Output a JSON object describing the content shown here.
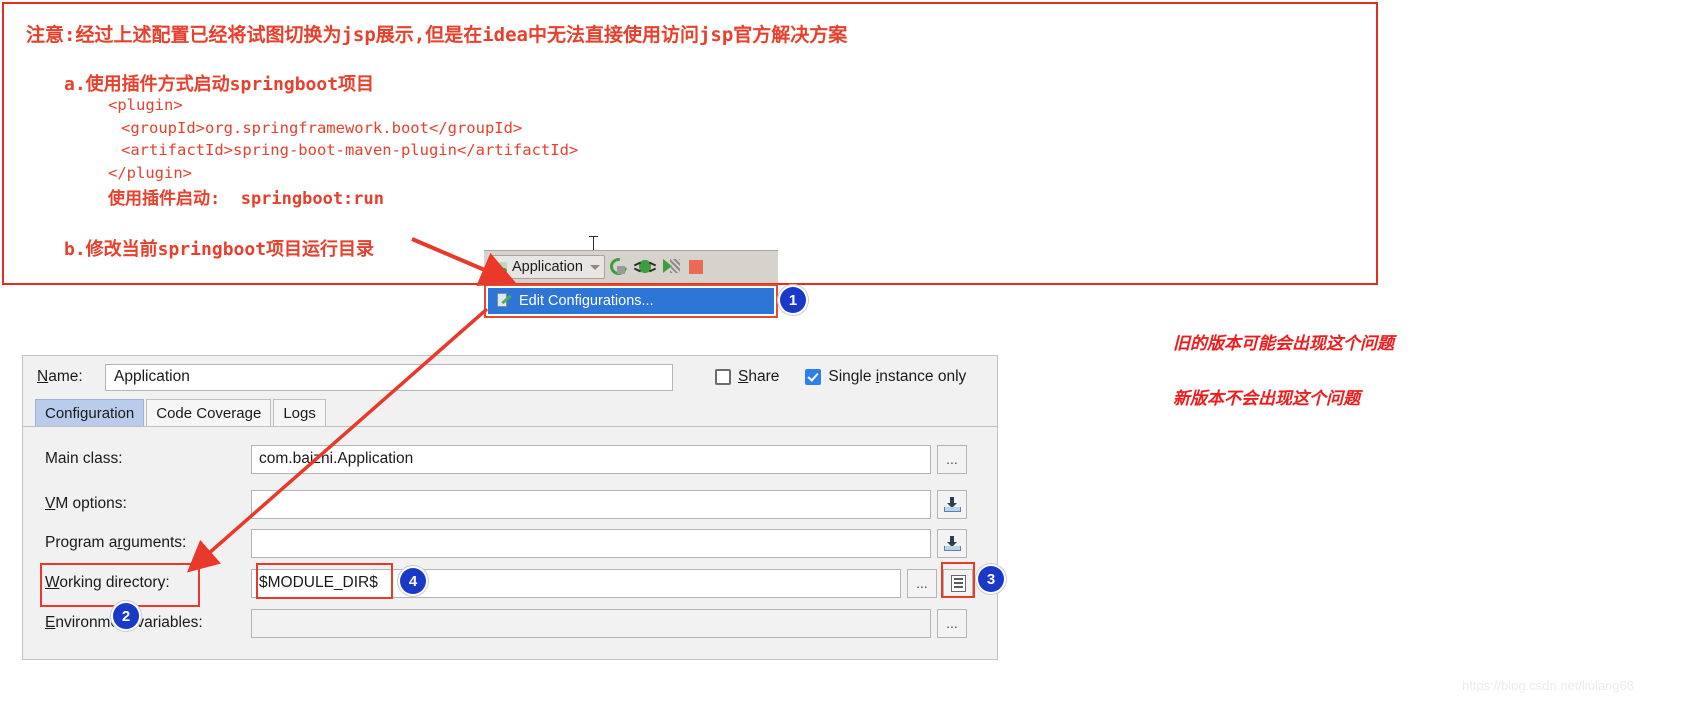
{
  "note": {
    "title": "注意:经过上述配置已经将试图切换为jsp展示,但是在idea中无法直接使用访问jsp官方解决方案",
    "item_a": "a.使用插件方式启动springboot项目",
    "code": [
      "<plugin>",
      "<groupId>org.springframework.boot</groupId>",
      "<artifactId>spring-boot-maven-plugin</artifactId>",
      "</plugin>",
      "使用插件启动:  springboot:run"
    ],
    "item_b": "b.修改当前springboot项目运行目录"
  },
  "toolbar": {
    "run_config_name": "Application",
    "icons": [
      "spring-leaf-icon",
      "chevron-down-icon",
      "run-icon",
      "debug-icon",
      "run-with-coverage-icon",
      "stop-icon"
    ]
  },
  "popup": {
    "edit_configurations_label": "Edit Configurations..."
  },
  "dialog": {
    "name_label": "Name:",
    "name_value": "Application",
    "share_label": "Share",
    "share_checked": false,
    "single_instance_label": "Single instance only",
    "single_instance_checked": true,
    "tabs": [
      {
        "label": "Configuration",
        "active": true
      },
      {
        "label": "Code Coverage",
        "active": false
      },
      {
        "label": "Logs",
        "active": false
      }
    ],
    "fields": [
      {
        "label": "Main class:",
        "value": "com.baizhi.Application",
        "aux": "ellipsis"
      },
      {
        "label": "VM options:",
        "value": "",
        "aux": "macro"
      },
      {
        "label": "Program arguments:",
        "value": "",
        "aux": "macro"
      },
      {
        "label": "Working directory:",
        "value": "$MODULE_DIR$",
        "aux": "ellipsis-and-lines"
      },
      {
        "label": "Environment variables:",
        "value": "",
        "aux": "ellipsis"
      }
    ],
    "aux_ellipsis_label": "..."
  },
  "badges": [
    "1",
    "2",
    "3",
    "4"
  ],
  "side_notes": {
    "old_version": "旧的版本可能会出现这个问题",
    "new_version": "新版本不会出现这个问题"
  },
  "watermark": "https://blog.csdn.net/liulang68",
  "colors": {
    "annotation_red": "#e8402c",
    "highlight_red": "#e8392b",
    "badge_blue": "#1a39c8",
    "selection_blue": "#2d75d6",
    "side_note_red": "#f21b1b"
  }
}
